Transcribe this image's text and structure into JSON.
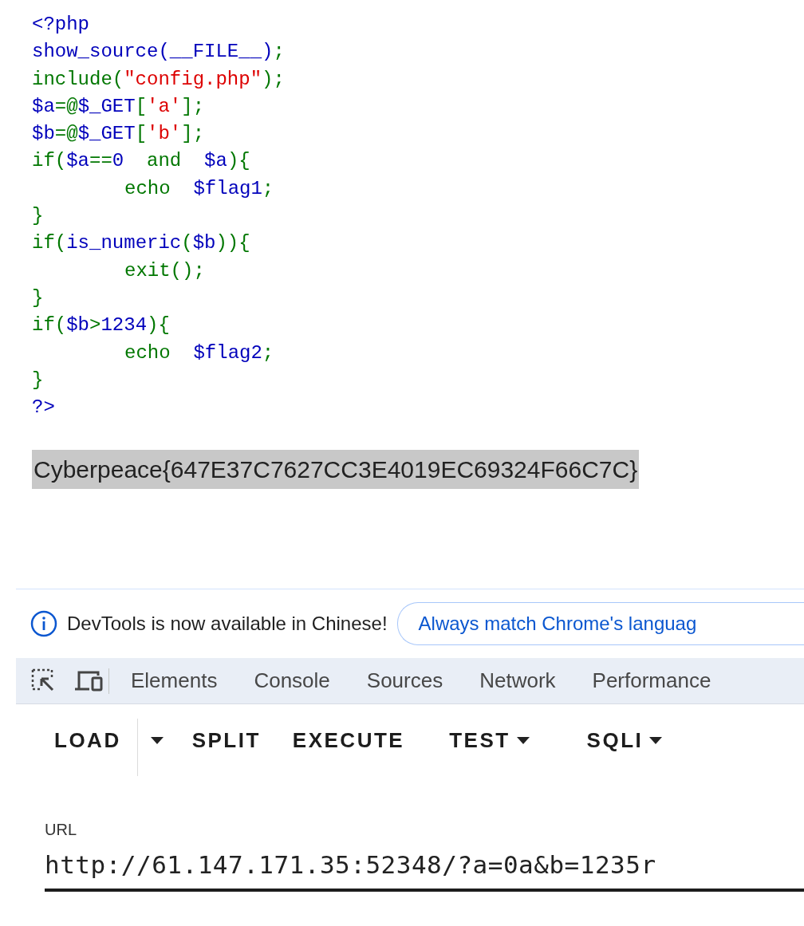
{
  "source_code": {
    "lines": [
      {
        "tokens": [
          {
            "text": "<?php",
            "color": "#0000bb"
          }
        ]
      },
      {
        "tokens": [
          {
            "text": "show_source(__FILE__)",
            "color": "#0000bb"
          },
          {
            "text": ";",
            "color": "#007700"
          }
        ]
      },
      {
        "tokens": [
          {
            "text": "include(",
            "color": "#007700"
          },
          {
            "text": "\"config.php\"",
            "color": "#dd0000"
          },
          {
            "text": ");",
            "color": "#007700"
          }
        ]
      },
      {
        "tokens": [
          {
            "text": "$a",
            "color": "#0000bb"
          },
          {
            "text": "=@",
            "color": "#007700"
          },
          {
            "text": "$_GET",
            "color": "#0000bb"
          },
          {
            "text": "[",
            "color": "#007700"
          },
          {
            "text": "'a'",
            "color": "#dd0000"
          },
          {
            "text": "];",
            "color": "#007700"
          }
        ]
      },
      {
        "tokens": [
          {
            "text": "$b",
            "color": "#0000bb"
          },
          {
            "text": "=@",
            "color": "#007700"
          },
          {
            "text": "$_GET",
            "color": "#0000bb"
          },
          {
            "text": "[",
            "color": "#007700"
          },
          {
            "text": "'b'",
            "color": "#dd0000"
          },
          {
            "text": "];",
            "color": "#007700"
          }
        ]
      },
      {
        "tokens": [
          {
            "text": "if(",
            "color": "#007700"
          },
          {
            "text": "$a",
            "color": "#0000bb"
          },
          {
            "text": "==",
            "color": "#007700"
          },
          {
            "text": "0",
            "color": "#0000bb"
          },
          {
            "text": "  and  ",
            "color": "#007700"
          },
          {
            "text": "$a",
            "color": "#0000bb"
          },
          {
            "text": "){",
            "color": "#007700"
          }
        ],
        "children": [
          {
            "tokens": [
              {
                "text": "echo  ",
                "color": "#007700"
              },
              {
                "text": "$flag1",
                "color": "#0000bb"
              },
              {
                "text": ";",
                "color": "#007700"
              }
            ]
          }
        ]
      },
      {
        "tokens": [
          {
            "text": "}",
            "color": "#007700"
          }
        ]
      },
      {
        "tokens": [
          {
            "text": "if(",
            "color": "#007700"
          },
          {
            "text": "is_numeric",
            "color": "#0000bb"
          },
          {
            "text": "(",
            "color": "#007700"
          },
          {
            "text": "$b",
            "color": "#0000bb"
          },
          {
            "text": ")){",
            "color": "#007700"
          }
        ],
        "children": [
          {
            "tokens": [
              {
                "text": "exit();",
                "color": "#007700"
              }
            ]
          }
        ]
      },
      {
        "tokens": [
          {
            "text": "}",
            "color": "#007700"
          }
        ]
      },
      {
        "tokens": [
          {
            "text": "if(",
            "color": "#007700"
          },
          {
            "text": "$b",
            "color": "#0000bb"
          },
          {
            "text": ">",
            "color": "#007700"
          },
          {
            "text": "1234",
            "color": "#0000bb"
          },
          {
            "text": "){",
            "color": "#007700"
          }
        ],
        "children": [
          {
            "tokens": [
              {
                "text": "echo  ",
                "color": "#007700"
              },
              {
                "text": "$flag2",
                "color": "#0000bb"
              },
              {
                "text": ";",
                "color": "#007700"
              }
            ]
          }
        ]
      },
      {
        "tokens": [
          {
            "text": "}",
            "color": "#007700"
          }
        ]
      },
      {
        "tokens": [
          {
            "text": "?>",
            "color": "#0000bb"
          }
        ]
      }
    ]
  },
  "output": {
    "text": "Cyberpeace{647E37C7627CC3E4019EC69324F66C7C}",
    "selected": true
  },
  "devtools": {
    "infobar": {
      "message": "DevTools is now available in Chinese!",
      "button": "Always match Chrome's languag"
    },
    "tabs": [
      {
        "label": "Elements",
        "selected": false
      },
      {
        "label": "Console",
        "selected": false
      },
      {
        "label": "Sources",
        "selected": false
      },
      {
        "label": "Network",
        "selected": false
      },
      {
        "label": "Performance",
        "selected": false
      }
    ],
    "hackbar": {
      "buttons": [
        {
          "kind": "button",
          "label": "LOAD"
        },
        {
          "kind": "split-caret"
        },
        {
          "kind": "button",
          "label": "SPLIT"
        },
        {
          "kind": "button",
          "label": "EXECUTE"
        },
        {
          "kind": "dropdown",
          "label": "TEST"
        },
        {
          "kind": "dropdown",
          "label": "SQLI"
        }
      ],
      "url_label": "URL",
      "url_value": "http://61.147.171.35:52348/?a=0a&b=1235r"
    }
  }
}
